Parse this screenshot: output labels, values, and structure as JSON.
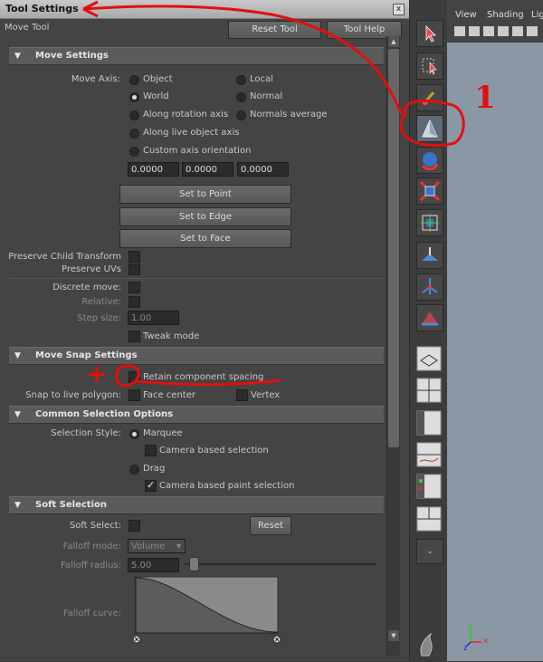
{
  "window": {
    "title": "Tool Settings",
    "close_glyph": "x"
  },
  "tool": {
    "name": "Move Tool",
    "reset_label": "Reset Tool",
    "help_label": "Tool Help"
  },
  "move_settings": {
    "header": "Move Settings",
    "axis_label": "Move Axis:",
    "axis_options": [
      {
        "label": "Object",
        "selected": false
      },
      {
        "label": "Local",
        "selected": false
      },
      {
        "label": "World",
        "selected": true
      },
      {
        "label": "Normal",
        "selected": false
      },
      {
        "label": "Along rotation axis",
        "selected": false
      },
      {
        "label": "Normals average",
        "selected": false
      },
      {
        "label": "Along live object axis",
        "selected": false
      },
      {
        "label": "Custom axis orientation",
        "selected": false
      }
    ],
    "orientation_values": [
      "0.0000",
      "0.0000",
      "0.0000"
    ],
    "set_to_point": "Set to Point",
    "set_to_edge": "Set to Edge",
    "set_to_face": "Set to Face",
    "preserve_child_transform": "Preserve Child Transform",
    "preserve_uvs": "Preserve UVs",
    "discrete_move": "Discrete move:",
    "relative": "Relative:",
    "step_size_label": "Step size:",
    "step_size_value": "1.00",
    "tweak_mode": "Tweak mode"
  },
  "move_snap": {
    "header": "Move Snap Settings",
    "retain_spacing": "Retain component spacing",
    "snap_live_label": "Snap to live polygon:",
    "face_center": "Face center",
    "vertex": "Vertex"
  },
  "common_selection": {
    "header": "Common Selection Options",
    "style_label": "Selection Style:",
    "marquee": "Marquee",
    "camera_based": "Camera based selection",
    "drag": "Drag",
    "camera_paint": "Camera based paint selection"
  },
  "soft_selection": {
    "header": "Soft Selection",
    "soft_select_label": "Soft Select:",
    "reset_label": "Reset",
    "falloff_mode_label": "Falloff mode:",
    "falloff_mode_value": "Volume",
    "falloff_radius_label": "Falloff radius:",
    "falloff_radius_value": "5.00",
    "falloff_curve_label": "Falloff curve:"
  },
  "annotations": {
    "number": "1",
    "plus": "+"
  },
  "viewport_menu": {
    "view": "View",
    "shading": "Shading",
    "lighting": "Lig"
  },
  "axis_gizmo": {
    "x": "x",
    "y": "y",
    "z": "z"
  },
  "colors": {
    "annotation_red": "#e01010",
    "title_bar": "#b8b8b8",
    "panel_bg": "#444444",
    "viewport_bg": "#8a97a5"
  },
  "icons": [
    "select-tool-icon",
    "lasso-tool-icon",
    "paint-select-icon",
    "move-tool-icon",
    "rotate-tool-icon",
    "scale-tool-icon",
    "manipulator-icon",
    "soft-mod-icon",
    "show-manipulator-icon",
    "last-tool-icon",
    "layout-single-icon",
    "layout-four-icon",
    "layout-outliner-icon",
    "layout-graph-icon",
    "layout-hypershade-icon",
    "layout-custom-icon",
    "maya-logo-icon"
  ]
}
